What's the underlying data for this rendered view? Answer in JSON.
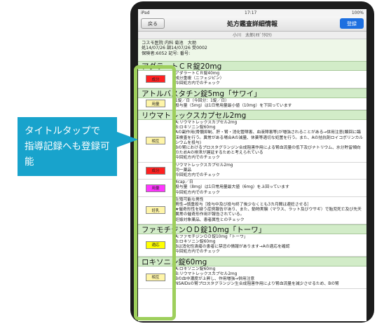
{
  "status": {
    "carrier": "iPad",
    "time": "17:17",
    "battery": "100%"
  },
  "nav": {
    "back": "戻る",
    "title": "処方鑑査詳細情報",
    "register": "登録"
  },
  "patient": "小川　太郎(ｵｶﾞﾜﾀﾛｳ)",
  "info": [
    "コスモ医院 内科 菊池　大助",
    "処14/07/26 調14/07/26 受0002",
    "保険者:6052 記号: 番号:"
  ],
  "drugs": [
    {
      "title": "アダラートＣＲ錠20mg",
      "rows": [
        {
          "tag": "成分",
          "color": "#ff2020",
          "lines": [
            "アダラートＣＲ錠40mg",
            "成分重複（ニフェジピン）",
            "今回処方内でのチェック"
          ]
        }
      ]
    },
    {
      "title": "アトルバスタチン錠5mg「サワイ」",
      "rows": [
        {
          "tag": "用量",
          "color": "#fff5a8",
          "lines": [
            "1錠／日（今回分：1錠／日）",
            "投与量（5mg）は1日常用量最小値（10mg）を下回っています"
          ]
        }
      ]
    },
    {
      "title": "リウマトレックスカプセル2mg",
      "rows": [
        {
          "tag": "相互",
          "color": "#fff5a8",
          "lines": [
            "A:リウマトレックスカプセル2mg",
            "B:ロキソニン錠60mg",
            "Aの副作用(骨髄抑制、肝・腎・消化管障害、血液障害等)が増強されることがある→併用注意(類回に臨床検査を行う。異常がある場合Aの減量、休薬等適切な処置を行う。また、Aの拮抗剤ロイコボリンカルシウムを投与)",
            "Bの腎におけるプロスタグランジン合成阻害作用による腎血流量の低下及びナトリウム、水分貯留傾向のためAの排泄が遅延するためと考えられている",
            "今回処方内でのチェック"
          ]
        },
        {
          "tag": "成分",
          "color": "#ff2020",
          "lines": [
            "リウマトレックスカプセル2mg",
            "同一薬品",
            "今回処方内でのチェック"
          ]
        },
        {
          "tag": "用量",
          "color": "#ff35ff",
          "lines": [
            "4cap／日",
            "投与量（8mg）は1日常用量最大値（6mg）を上回っています",
            "今回処方内でのチェック"
          ]
        },
        {
          "tag": "妊乳",
          "color": "#fff5a8",
          "lines": [
            "生殖可能な男性",
            "男性→慎重投与［投与中及び投与終了後少なくとも3カ月間は避妊させる］",
            "★催奇形性を疑う症例報告があり、また、動物実験（マウス、ラット及びウサギ）で胎児死亡及び先天異常の催奇形作用が報告されている。",
            "妊娠対象薬品、患者属性とのチェック"
          ]
        }
      ]
    },
    {
      "title": "ファモチジンＯＤ錠10mg「トーワ」",
      "rows": [
        {
          "tag": "適応",
          "color": "#ffff00",
          "lines": [
            "A:ファモチジンＯＤ錠10mg「トーワ」",
            "B:ロキソニン錠60mg",
            "Bは消化性潰瘍の患者に禁忌の情報があります→Aの適応を確認",
            "今回処方内でのチェック"
          ]
        }
      ]
    },
    {
      "title": "ロキソニン錠60mg",
      "rows": [
        {
          "tag": "相互",
          "color": "#fff5a8",
          "lines": [
            "A:ロキソニン錠60mg",
            "B:リウマトレックスカプセル2mg",
            "Bの血中濃度が上昇し、作用増強→併用注意",
            "NSAIDsの腎プロスタグランジン生合成阻害作用により腎血流量を減少させるため、Bの腎"
          ]
        }
      ]
    }
  ],
  "callout": [
    "タイトルタップで",
    "指導記録へも登録可能"
  ]
}
